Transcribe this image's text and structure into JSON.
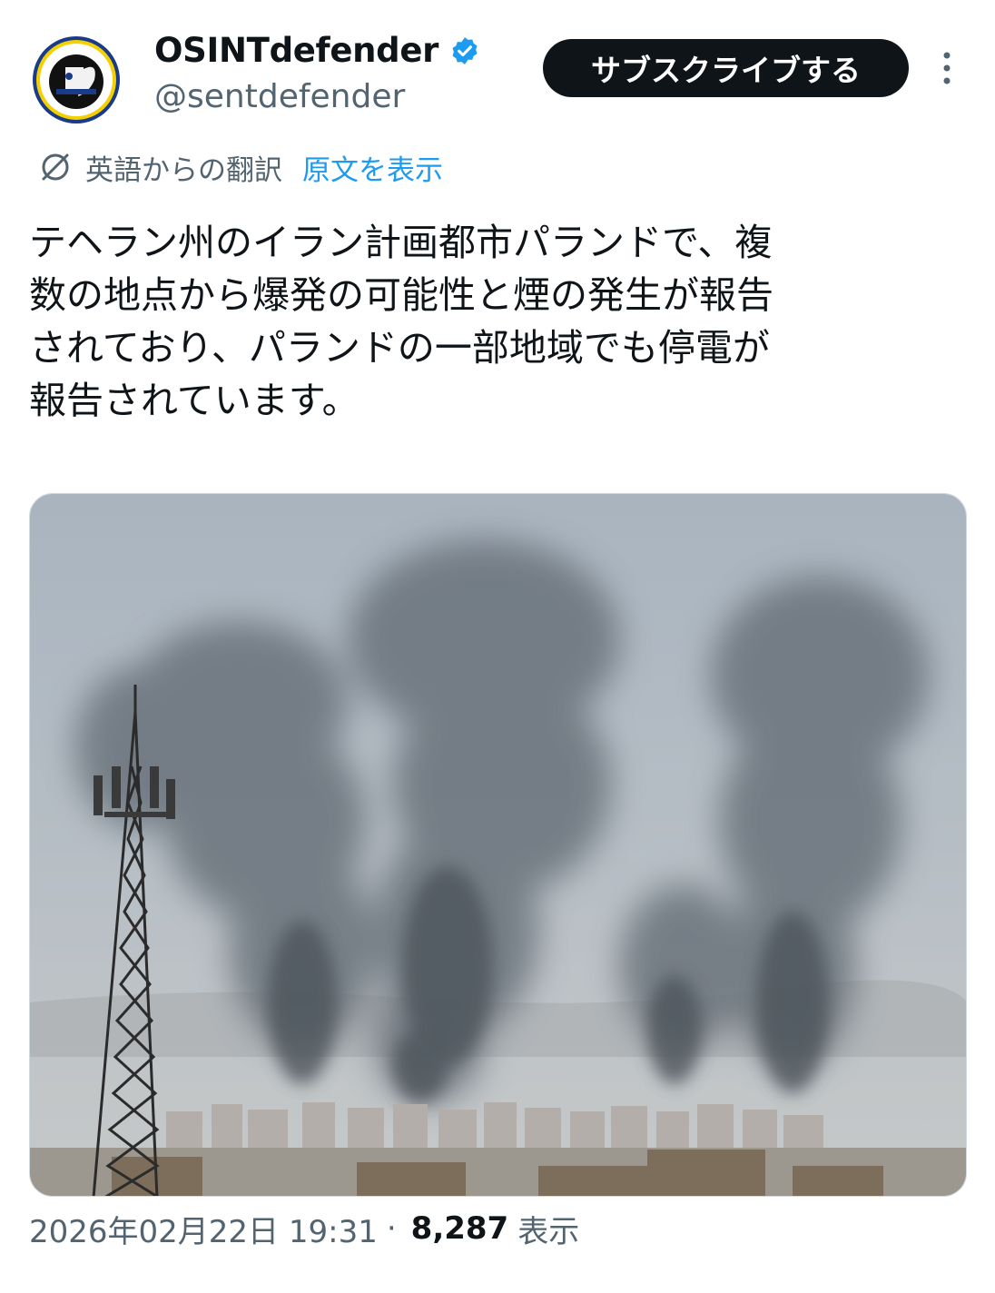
{
  "author": {
    "display_name": "OSINTdefender",
    "handle": "@sentdefender",
    "verified": true,
    "avatar_icon": "osint-defender-logo"
  },
  "header": {
    "subscribe_label": "サブスクライブする",
    "more_icon": "vertical-dots-icon"
  },
  "translation": {
    "label": "英語からの翻訳",
    "show_original": "原文を表示",
    "icon": "translate-icon"
  },
  "tweet": {
    "text": "テヘラン州のイラン計画都市パランドで、複\n数の地点から爆発の可能性と煙の発生が報告\nされており、パランドの一部地域でも停電が\n報告されています。"
  },
  "media": {
    "description_icon": "smoke-plumes-photo"
  },
  "meta": {
    "timestamp": "2026年02月22日 19:31",
    "separator": "·",
    "views": "8,287",
    "views_label": "表示"
  },
  "colors": {
    "accent": "#1d9bf0",
    "text": "#0f1419",
    "secondary": "#536471",
    "button_bg": "#0f1419"
  }
}
